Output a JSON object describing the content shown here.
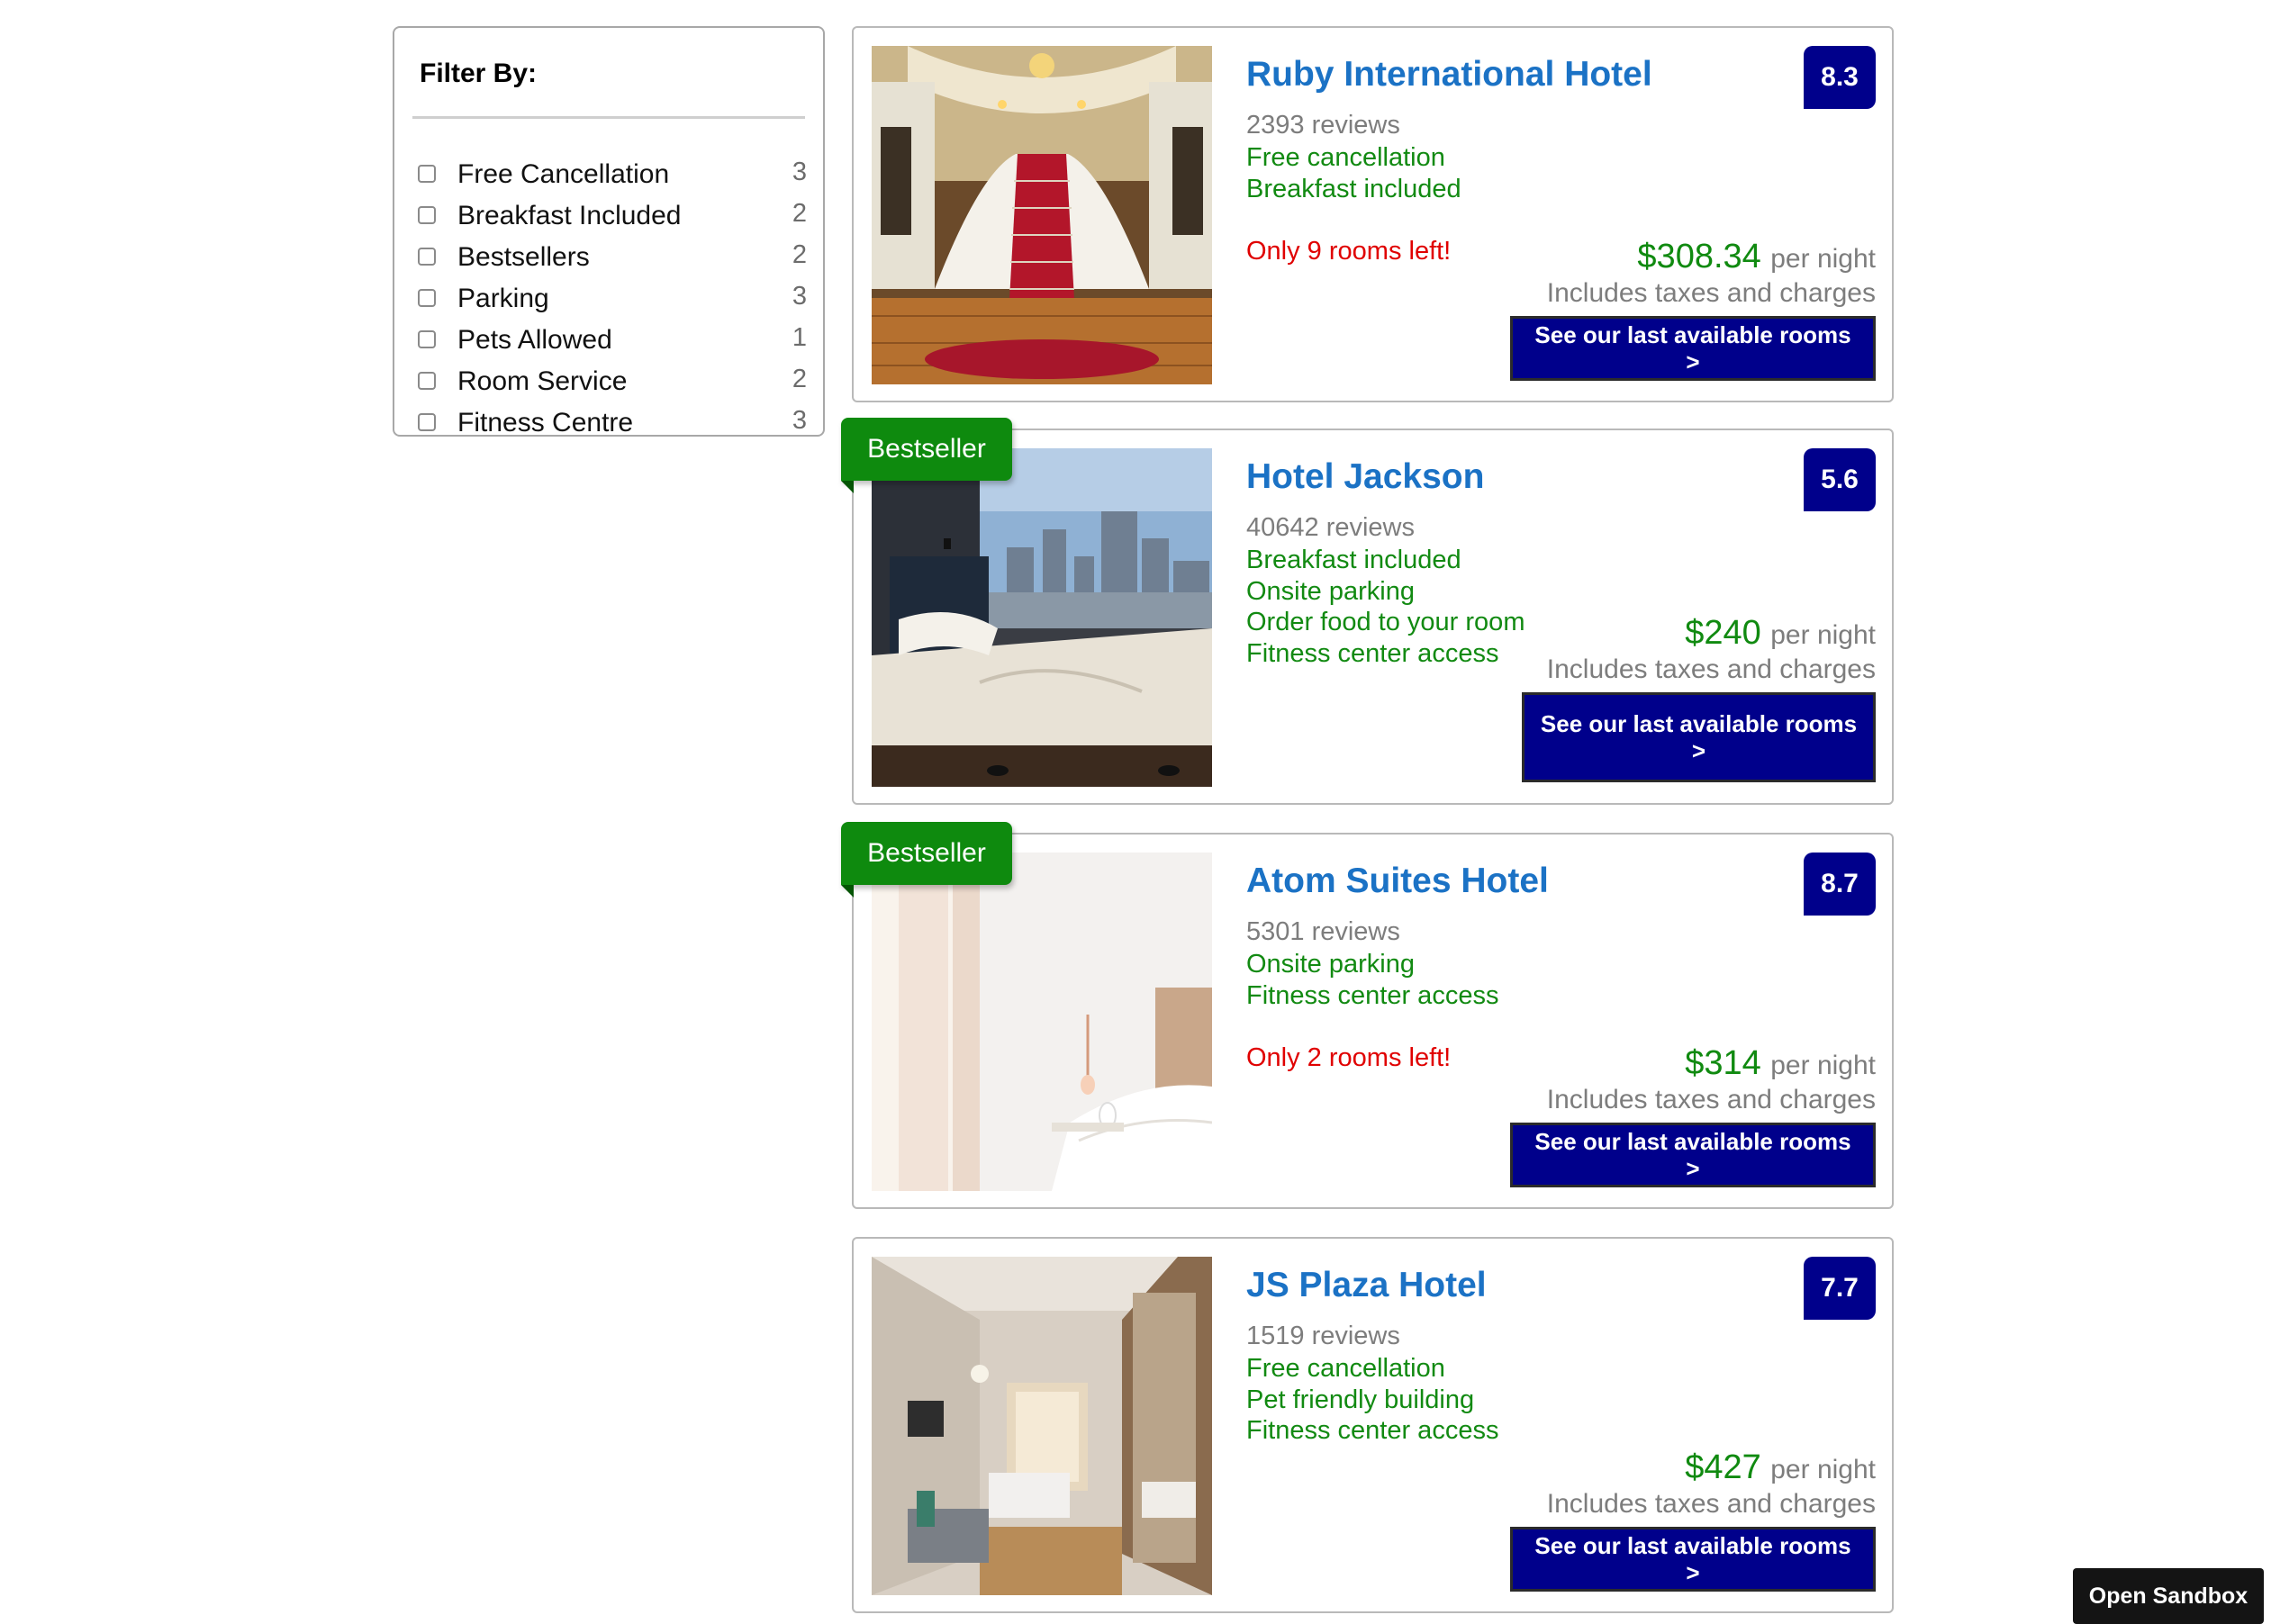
{
  "filter": {
    "title": "Filter By:",
    "options": [
      {
        "label": "Free Cancellation",
        "count": "3"
      },
      {
        "label": "Breakfast Included",
        "count": "2"
      },
      {
        "label": "Bestsellers",
        "count": "2"
      },
      {
        "label": "Parking",
        "count": "3"
      },
      {
        "label": "Pets Allowed",
        "count": "1"
      },
      {
        "label": "Room Service",
        "count": "2"
      },
      {
        "label": "Fitness Centre",
        "count": "3"
      }
    ]
  },
  "hotels": [
    {
      "name": "Ruby International Hotel",
      "score": "8.3",
      "reviews": "2393 reviews",
      "features": [
        "Free cancellation",
        "Breakfast included"
      ],
      "rooms_left": "Only 9 rooms left!",
      "price": "$308.34",
      "per_night": "per night",
      "taxes": "Includes taxes and charges",
      "cta": "See our last available rooms >",
      "photo": "grand-staircase-photo"
    },
    {
      "name": "Hotel Jackson",
      "score": "5.6",
      "reviews": "40642 reviews",
      "features": [
        "Breakfast included",
        "Onsite parking",
        "Order food to your room",
        "Fitness center access"
      ],
      "price": "$240",
      "per_night": "per night",
      "taxes": "Includes taxes and charges",
      "cta": "See our last available rooms >",
      "badge": "Bestseller",
      "photo": "city-view-bedroom-photo"
    },
    {
      "name": "Atom Suites Hotel",
      "score": "8.7",
      "reviews": "5301 reviews",
      "features": [
        "Onsite parking",
        "Fitness center access"
      ],
      "rooms_left": "Only 2 rooms left!",
      "price": "$314",
      "per_night": "per night",
      "taxes": "Includes taxes and charges",
      "cta": "See our last available rooms >",
      "badge": "Bestseller",
      "photo": "bright-bedroom-photo"
    },
    {
      "name": "JS Plaza Hotel",
      "score": "7.7",
      "reviews": "1519 reviews",
      "features": [
        "Free cancellation",
        "Pet friendly building",
        "Fitness center access"
      ],
      "price": "$427",
      "per_night": "per night",
      "taxes": "Includes taxes and charges",
      "cta": "See our last available rooms >",
      "photo": "hotel-room-photo"
    }
  ],
  "sandbox_button": "Open Sandbox",
  "colors": {
    "hotel_name": "#1b72c5",
    "score_badge": "#00008b",
    "feature": "#128a12",
    "price": "#108a10",
    "rooms_left": "#e00000",
    "bestseller": "#0e8a0e"
  }
}
